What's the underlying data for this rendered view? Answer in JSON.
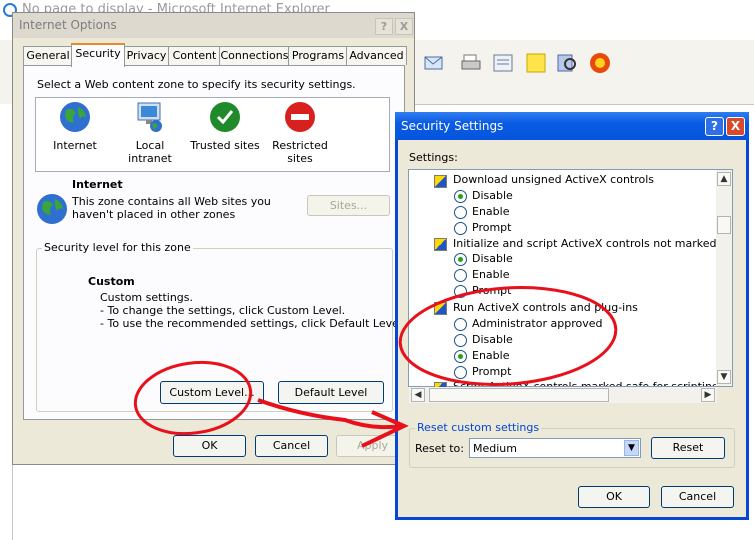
{
  "browser": {
    "title": "No page to display - Microsoft Internet Explorer"
  },
  "internet_options": {
    "title": "Internet Options",
    "help_btn": "?",
    "close_btn": "X",
    "tabs": [
      "General",
      "Security",
      "Privacy",
      "Content",
      "Connections",
      "Programs",
      "Advanced"
    ],
    "zone_prompt": "Select a Web content zone to specify its security settings.",
    "zones": [
      "Internet",
      "Local intranet",
      "Trusted sites",
      "Restricted sites"
    ],
    "zone_title": "Internet",
    "zone_desc_1": "This zone contains all Web sites you",
    "zone_desc_2": "haven't placed in other zones",
    "sites_btn": "Sites...",
    "level_group": "Security level for this zone",
    "level_name": "Custom",
    "level_lines": [
      "Custom settings.",
      "- To change the settings, click Custom Level.",
      "- To use the recommended settings, click Default Level."
    ],
    "custom_level_btn": "Custom Level...",
    "default_level_btn": "Default Level",
    "ok_btn": "OK",
    "cancel_btn": "Cancel",
    "apply_btn": "Apply"
  },
  "security_settings": {
    "title": "Security Settings",
    "help_btn": "?",
    "close_btn": "X",
    "settings_label": "Settings:",
    "items": [
      {
        "label": "Download unsigned ActiveX controls",
        "options": [
          "Disable",
          "Enable",
          "Prompt"
        ],
        "selected": 0
      },
      {
        "label": "Initialize and script ActiveX controls not marked as safe",
        "options": [
          "Disable",
          "Enable",
          "Prompt"
        ],
        "selected": 0
      },
      {
        "label": "Run ActiveX controls and plug-ins",
        "options": [
          "Administrator approved",
          "Disable",
          "Enable",
          "Prompt"
        ],
        "selected": 2
      },
      {
        "label": "Script ActiveX controls marked safe for scripting"
      }
    ],
    "reset_group": "Reset custom settings",
    "reset_to_label": "Reset to:",
    "reset_value": "Medium",
    "reset_btn": "Reset",
    "ok_btn": "OK",
    "cancel_btn": "Cancel"
  },
  "colors": {
    "annotation": "#e8101a",
    "titlebar": "#0a5be3"
  }
}
